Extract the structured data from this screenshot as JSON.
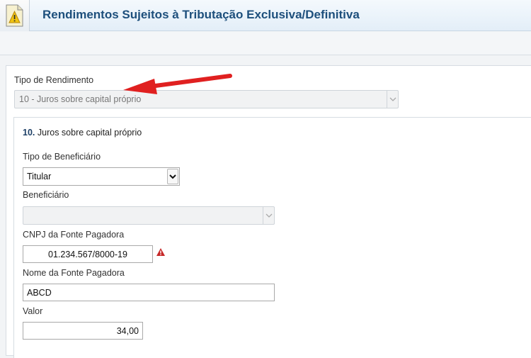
{
  "header": {
    "title": "Rendimentos Sujeitos à Tributação Exclusiva/Definitiva",
    "icon": "warning-document-icon"
  },
  "form": {
    "tipo_rendimento_label": "Tipo de Rendimento",
    "tipo_rendimento_value": "10 - Juros sobre capital próprio",
    "section_number": "10.",
    "section_title": "Juros sobre capital próprio",
    "tipo_beneficiario_label": "Tipo de Beneficiário",
    "tipo_beneficiario_value": "Titular",
    "beneficiario_label": "Beneficiário",
    "beneficiario_value": "",
    "cnpj_label": "CNPJ da Fonte Pagadora",
    "cnpj_value": "01.234.567/8000-19",
    "nome_fonte_label": "Nome da Fonte Pagadora",
    "nome_fonte_value": "ABCD",
    "valor_label": "Valor",
    "valor_value": "34,00"
  },
  "colors": {
    "title": "#1d4f7c",
    "annotation_arrow": "#e02020",
    "warning": "#c62828"
  }
}
